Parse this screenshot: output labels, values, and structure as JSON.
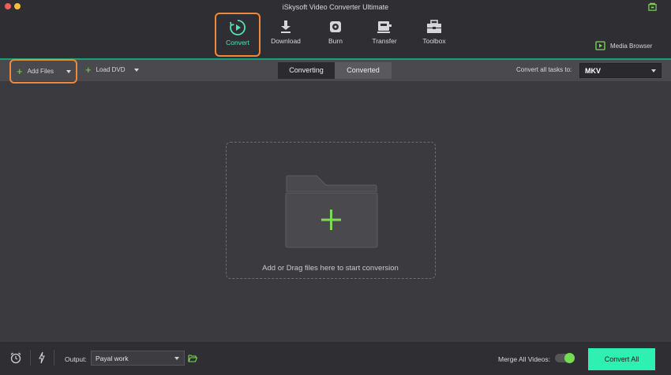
{
  "window": {
    "title": "iSkysoft Video Converter Ultimate"
  },
  "nav": {
    "convert": "Convert",
    "download": "Download",
    "burn": "Burn",
    "transfer": "Transfer",
    "toolbox": "Toolbox",
    "media_browser": "Media Browser"
  },
  "toolbar": {
    "add_files": "Add Files",
    "load_dvd": "Load DVD",
    "tabs": [
      {
        "label": "Converting",
        "active": true
      },
      {
        "label": "Converted",
        "active": false
      }
    ],
    "convert_all_label": "Convert all tasks to:",
    "format_value": "MKV"
  },
  "main": {
    "drop_text": "Add or Drag files here to start conversion"
  },
  "footer": {
    "output_label": "Output:",
    "output_value": "Payal work",
    "merge_label": "Merge All Videos:",
    "merge_enabled": true,
    "convert_all_button": "Convert All"
  },
  "colors": {
    "accent": "#2ef0b1",
    "highlight": "#f0873a",
    "plus": "#7ed957"
  },
  "icons": [
    "convert-icon",
    "download-icon",
    "burn-icon",
    "transfer-icon",
    "toolbox-icon",
    "media-browser-icon",
    "plus-icon",
    "folder-icon",
    "alarm-icon",
    "bolt-icon",
    "folder-open-icon",
    "store-icon"
  ]
}
